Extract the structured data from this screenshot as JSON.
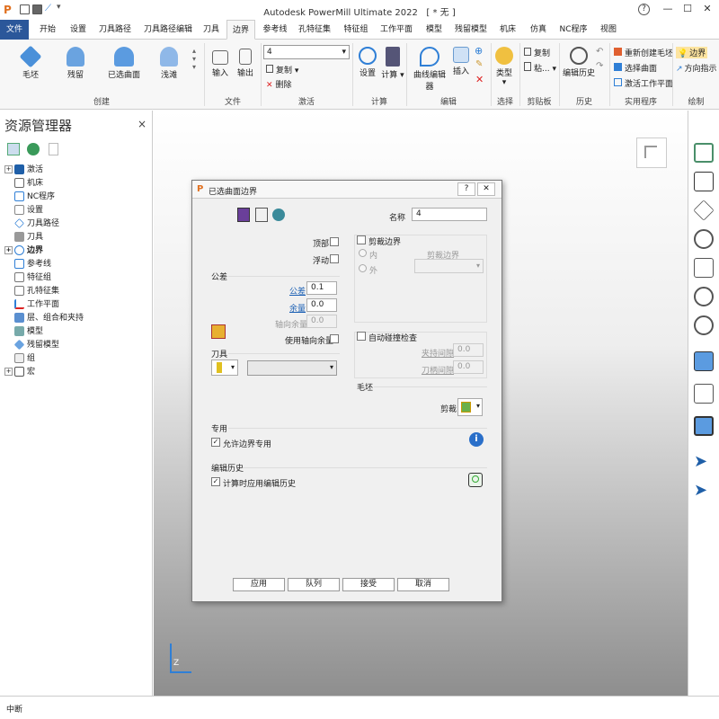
{
  "app": {
    "title": "Autodesk PowerMill Ultimate 2022",
    "doc": "[ * 无 ]"
  },
  "menu": {
    "file": "文件",
    "tabs": [
      "开始",
      "设置",
      "刀具路径",
      "刀具路径编辑",
      "刀具",
      "边界",
      "参考线",
      "孔特征集",
      "特征组",
      "工作平面",
      "模型",
      "残留模型",
      "机床",
      "仿真",
      "NC程序",
      "视图"
    ]
  },
  "ribbon": {
    "groups": {
      "create": "创建",
      "file": "文件",
      "activate": "激活",
      "calc": "计算",
      "edit": "编辑",
      "select": "选择",
      "clipboard": "剪贴板",
      "history": "历史",
      "utility": "实用程序",
      "draw": "绘制"
    },
    "create_buttons": [
      "毛坯",
      "残留",
      "已选曲面",
      "浅滩"
    ],
    "file_buttons": [
      "输入",
      "输出"
    ],
    "activate_value": "4",
    "copy": "复制",
    "delete": "删除",
    "calc_buttons": [
      "设置",
      "计算"
    ],
    "edit_buttons": [
      "曲线编辑器",
      "插入"
    ],
    "select_button": "类型",
    "clipboard_items": [
      "复制",
      "粘..."
    ],
    "history_button": "编辑历史",
    "utility_items": [
      "重新创建毛坯",
      "选择曲面",
      "激活工作平面"
    ],
    "draw_items": [
      "边界",
      "方向指示"
    ]
  },
  "explorer": {
    "title": "资源管理器",
    "items": [
      "激活",
      "机床",
      "NC程序",
      "设置",
      "刀具路径",
      "刀具",
      "边界",
      "参考线",
      "特征组",
      "孔特征集",
      "工作平面",
      "层、组合和夹持",
      "模型",
      "残留模型",
      "组",
      "宏"
    ]
  },
  "dialog": {
    "title": "已选曲面边界",
    "help": "?",
    "close": "✕",
    "name_label": "名称",
    "name_value": "4",
    "top_label": "顶部",
    "float_label": "浮动",
    "tolerance_group": "公差",
    "tol_label": "公差",
    "tol_value": "0.1",
    "allow_label": "余量",
    "allow_value": "0.0",
    "axial_label": "轴向余量",
    "axial_value": "0.0",
    "use_axial_label": "使用轴向余量",
    "tool_group": "刀具",
    "trim_group": "剪裁边界",
    "inside": "内",
    "outside": "外",
    "trim_field_label": "剪裁边界",
    "collision_group": "自动碰撞检查",
    "holder_label": "夹持间隙",
    "holder_value": "0.0",
    "shank_label": "刀柄间隙",
    "shank_value": "0.0",
    "stock_group": "毛坯",
    "stock_trim_label": "剪裁",
    "special_group": "专用",
    "allow_special": "允许边界专用",
    "allow_special_checked": "✓",
    "history_group": "编辑历史",
    "apply_history": "计算时应用编辑历史",
    "apply_history_checked": "✓",
    "buttons": {
      "apply": "应用",
      "queue": "队列",
      "accept": "接受",
      "cancel": "取消"
    }
  },
  "status": {
    "text": "中断"
  },
  "axis": {
    "z": "Z"
  },
  "colors": {
    "file_tab": "#2b579a",
    "link": "#1a5fb4",
    "accent": "#2f7fd6"
  }
}
